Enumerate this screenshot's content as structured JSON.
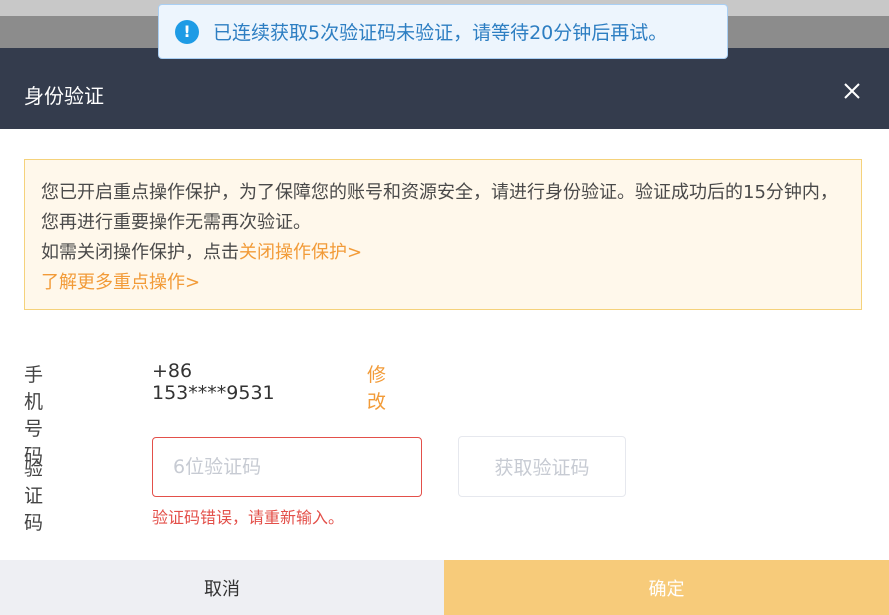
{
  "toast": {
    "message": "已连续获取5次验证码未验证，请等待20分钟后再试。"
  },
  "dialog": {
    "title": "身份验证",
    "notice": {
      "line1": "您已开启重点操作保护，为了保障您的账号和资源安全，请进行身份验证。验证成功后的15分钟内，您再进行重要操作无需再次验证。",
      "line2_prefix": "如需关闭操作保护，点击",
      "close_protection_link": "关闭操作保护>",
      "learn_more_link": "了解更多重点操作>"
    },
    "phone_label": "手机号码",
    "phone_value": "+86 153****9531",
    "modify_link": "修改",
    "code_label": "验证码",
    "code_placeholder": "6位验证码",
    "get_code_button": "获取验证码",
    "error_message": "验证码错误，请重新输入。",
    "cancel_button": "取消",
    "confirm_button": "确定"
  },
  "colors": {
    "header_bg": "#343c4d",
    "accent_orange": "#f29b38",
    "error_red": "#e3504a",
    "confirm_bg": "#f7cb7a",
    "info_blue": "#1e9be5"
  }
}
